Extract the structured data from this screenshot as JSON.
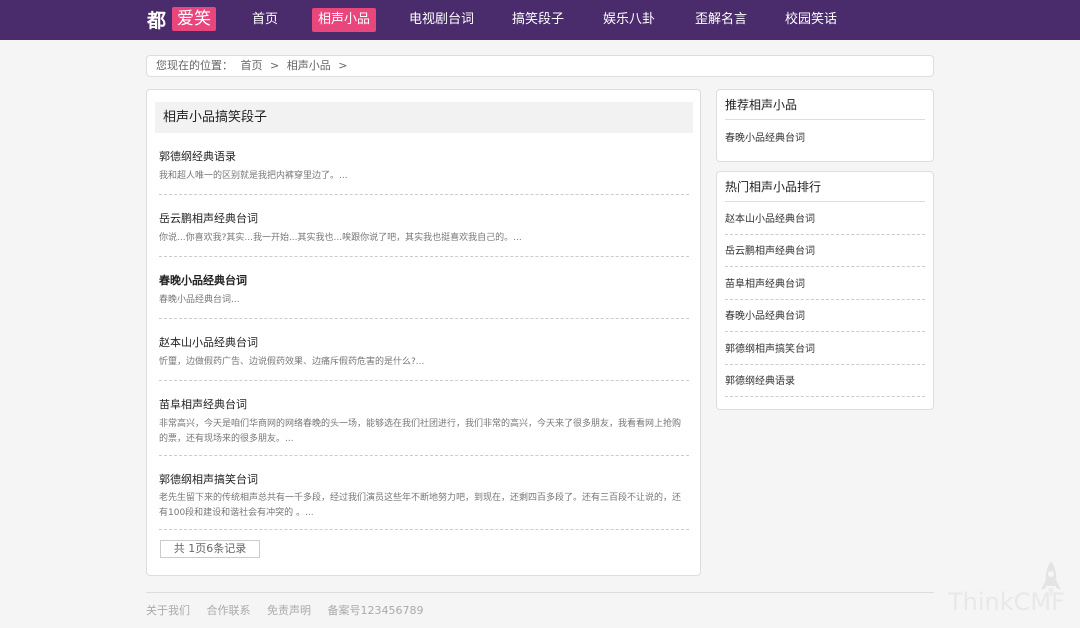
{
  "logo": {
    "part1": "都",
    "part2": "爱笑"
  },
  "nav": {
    "items": [
      {
        "label": "首页",
        "active": false
      },
      {
        "label": "相声小品",
        "active": true
      },
      {
        "label": "电视剧台词",
        "active": false
      },
      {
        "label": "搞笑段子",
        "active": false
      },
      {
        "label": "娱乐八卦",
        "active": false
      },
      {
        "label": "歪解名言",
        "active": false
      },
      {
        "label": "校园笑话",
        "active": false
      }
    ]
  },
  "breadcrumb": {
    "prefix": "您现在的位置：",
    "home": "首页",
    "sep1": ">",
    "current": "相声小品",
    "sep2": ">"
  },
  "main": {
    "heading": "相声小品搞笑段子",
    "posts": [
      {
        "title": "郭德纲经典语录",
        "excerpt": "我和超人唯一的区别就是我把内裤穿里边了。..."
      },
      {
        "title": "岳云鹏相声经典台词",
        "excerpt": "你说...你喜欢我?其实...我一开始...其实我也...唉跟你说了吧，其实我也挺喜欢我自己的。..."
      },
      {
        "title": "春晚小品经典台词",
        "excerpt": "春晚小品经典台词..."
      },
      {
        "title": "赵本山小品经典台词",
        "excerpt": "忻璽，边做假药广告、边说假药效果、边痛斥假药危害的是什么?..."
      },
      {
        "title": "苗阜相声经典台词",
        "excerpt": "非常高兴，今天是咱们华商网的网络春晚的头一场，能够选在我们社团进行，我们非常的高兴，今天来了很多朋友，我看看网上抢购的票，还有现场来的很多朋友。..."
      },
      {
        "title": "郭德纲相声搞笑台词",
        "excerpt": "老先生留下来的传统相声总共有一千多段，经过我们演员这些年不断地努力吧，到现在，还剩四百多段了。还有三百段不让说的，还有100段和建设和谐社会有冲突的 。..."
      }
    ],
    "pager": "共 1页6条记录"
  },
  "sidebar": {
    "recommend": {
      "title": "推荐相声小品",
      "items": [
        "春晚小品经典台词"
      ]
    },
    "hot": {
      "title": "热门相声小品排行",
      "items": [
        "赵本山小品经典台词",
        "岳云鹏相声经典台词",
        "苗阜相声经典台词",
        "春晚小品经典台词",
        "郭德纲相声搞笑台词",
        "郭德纲经典语录"
      ]
    }
  },
  "footer": {
    "links": [
      "关于我们",
      "合作联系",
      "免责声明",
      "备案号123456789"
    ]
  },
  "watermark": "ThinkCMF",
  "colors": {
    "nav_bg": "#4a2b6b",
    "accent": "#e8467c"
  }
}
